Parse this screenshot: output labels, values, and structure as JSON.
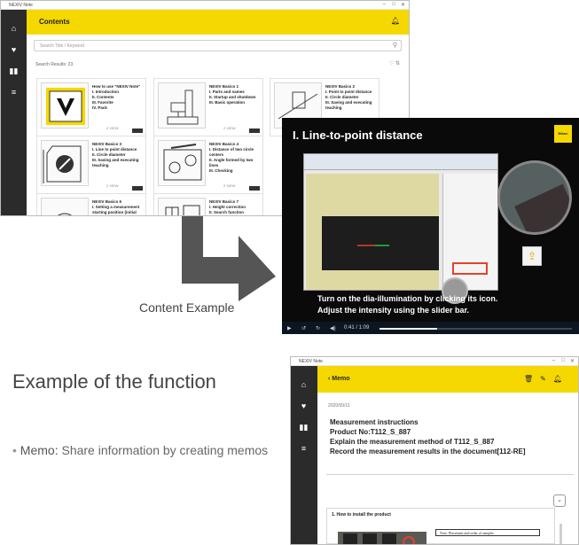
{
  "contents_window": {
    "title": "NEXIV Note",
    "header_title": "Contents",
    "search_placeholder": "Search Title / Keyword",
    "results_label": "Search Results: 23",
    "cards": [
      {
        "text": "How to use \"NEXIV Note\"\nI. Introduction\nII. Contents\nIII. Favorite\nIV. Pack",
        "views": "3 VIEW"
      },
      {
        "text": "NEXIV Basics 1\nI. Parts and names\nII. Startup and shutdown\nIII. Basic operation",
        "views": "2 VIEW"
      },
      {
        "text": "NEXIV Basics 2\nI. Point to point distance\nII. Circle diameter\nIII. Saving and executing teaching",
        "views": ""
      },
      {
        "text": "NEXIV Basics 3\nI. Line to point distance\nII. Circle diameter\nIII. Saving and executing teaching",
        "views": "2 VIEW"
      },
      {
        "text": "NEXIV Basics 4\nI. Distance of two circle centers\nII. Angle formed by two lines\nIII. Checking",
        "views": "2 VIEW"
      },
      {
        "text": "NEXIV Basics 6\nI. Setting a measurement starting position (initial",
        "views": ""
      },
      {
        "text": "NEXIV Basics 7\nI. Height correction\nII. Search function\nIII. Correcting the",
        "views": ""
      }
    ]
  },
  "video": {
    "title": "I. Line-to-point distance",
    "logo": "Nikon",
    "subtitle_line1": "Turn on the dia-illumination by clicking its icon.",
    "subtitle_line2": "Adjust the intensity using the slider bar.",
    "time": "0:41 / 1:09",
    "progress": 0.3
  },
  "caption": "Content Example",
  "heading": "Example of the function",
  "bullet": {
    "label": "Memo:",
    "text": " Share information by creating memos"
  },
  "memo_window": {
    "title": "NEXIV Note",
    "header_title": "Memo",
    "date": "2020/09/11",
    "lines": [
      "Measurement instructions",
      "Product No:T112_S_887",
      "Explain the measurement method of T112_S_887",
      "Record the measurement results in the document[112-RE]"
    ],
    "section_title": "1. How to install the product",
    "note": "Note: Placement and order of samples"
  },
  "colors": {
    "accent_yellow": "#f5d800",
    "sidebar": "#2b2b2b",
    "arrow": "#555555",
    "highlight_red": "#e5412d"
  }
}
